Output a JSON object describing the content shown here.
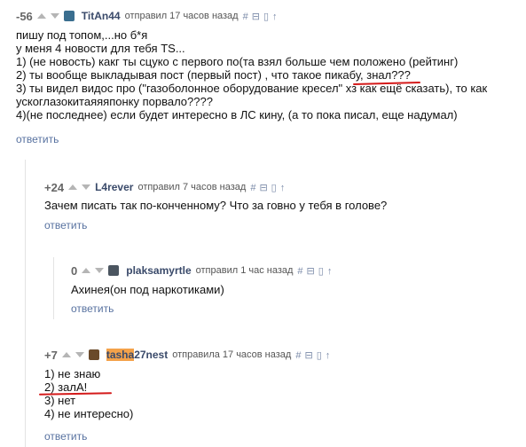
{
  "comments": [
    {
      "score": "-56",
      "username": "TitAn44",
      "action": "отправил 17 часов назад",
      "lines": [
        "пишу под топом,...но б*я",
        "у меня 4 новости для тебя TS...",
        "1) (не новость) какг ты сцуко с первого по(та взял больше чем положено (рейтинг)",
        "2) ты вообще выкладывая пост (первый пост) , что такое пикабу, знал???",
        "3) ты видел видос про (\"газоболонное оборудование кресел\" хз как ещё сказать), то как",
        "ускоглазокитаяяяпонку порвало????",
        "4)(не последнее) если будет интересно в ЛС кину, (а то пока писал, еще надумал)"
      ],
      "reply": "ответить"
    },
    {
      "score": "+24",
      "username": "L4rever",
      "action": "отправил 7 часов назад",
      "lines": [
        "Зачем писать так по-конченному? Что за говно у тебя в голове?"
      ],
      "reply": "ответить"
    },
    {
      "score": "0",
      "username": "plaksamyrtle",
      "action": "отправил 1 час назад",
      "lines": [
        "Ахинея(он под наркотиками)"
      ],
      "reply": "ответить"
    },
    {
      "score": "+7",
      "username_highlight": "tasha",
      "username_rest": "27nest",
      "action": "отправила 17 часов назад",
      "lines": [
        "1) не знаю",
        "2) залА!",
        "3) нет",
        "4) не интересно)"
      ],
      "reply": "ответить"
    }
  ],
  "icons": [
    "hash-icon",
    "collapse-icon",
    "save-icon",
    "up-arrow-icon"
  ],
  "colors": {
    "underline": "#d41a1a",
    "highlight": "#f4a24a",
    "link": "#5872a0"
  }
}
